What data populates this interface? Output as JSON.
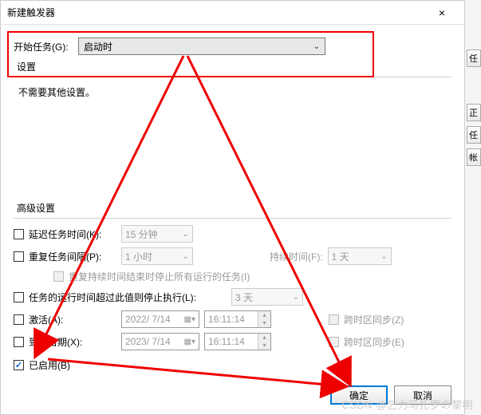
{
  "titlebar": {
    "title": "新建触发器",
    "close_icon": "×"
  },
  "start": {
    "label": "开始任务(G):",
    "value": "启动时"
  },
  "settings": {
    "heading": "设置",
    "message": "不需要其他设置。"
  },
  "advanced": {
    "heading": "高级设置",
    "delay": {
      "label": "延迟任务时间(K):",
      "value": "15 分钟"
    },
    "repeat": {
      "label": "重复任务间隔(P):",
      "value": "1 小时",
      "duration_label": "持续时间(F):",
      "duration_value": "1 天",
      "stop_label": "重复持续时间结束时停止所有运行的任务(I)"
    },
    "stop_after": {
      "label": "任务的运行时间超过此值则停止执行(L):",
      "value": "3 天"
    },
    "activate": {
      "label": "激活(A):",
      "date": "2022/ 7/14",
      "time": "16:11:14",
      "tz_label": "跨时区同步(Z)"
    },
    "expire": {
      "label": "到期日期(X):",
      "date": "2023/ 7/14",
      "time": "16:11:14",
      "tz_label": "跨时区同步(E)"
    },
    "enabled": {
      "label": "已启用(B)"
    }
  },
  "footer": {
    "ok": "确定",
    "cancel": "取消"
  },
  "peek": {
    "b1": "任",
    "b2": "正",
    "b3": "任",
    "b4": "帐"
  },
  "watermark": "CSDN @乞力马扎罗の黎明"
}
